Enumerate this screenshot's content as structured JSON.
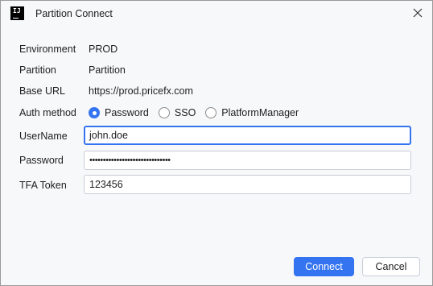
{
  "window": {
    "title": "Partition Connect"
  },
  "info": {
    "environment_label": "Environment",
    "environment_value": "PROD",
    "partition_label": "Partition",
    "partition_value": "Partition",
    "base_url_label": "Base URL",
    "base_url_value": "https://prod.pricefx.com"
  },
  "auth": {
    "label": "Auth method",
    "options": [
      "Password",
      "SSO",
      "PlatformManager"
    ],
    "selected": "Password"
  },
  "fields": {
    "username_label": "UserName",
    "username_value": "john.doe",
    "password_label": "Password",
    "password_value": "••••••••••••••••••••••••••••••",
    "tfa_label": "TFA Token",
    "tfa_value": "123456"
  },
  "buttons": {
    "connect": "Connect",
    "cancel": "Cancel"
  },
  "colors": {
    "accent": "#3574f0",
    "background": "#f7f8fa"
  }
}
